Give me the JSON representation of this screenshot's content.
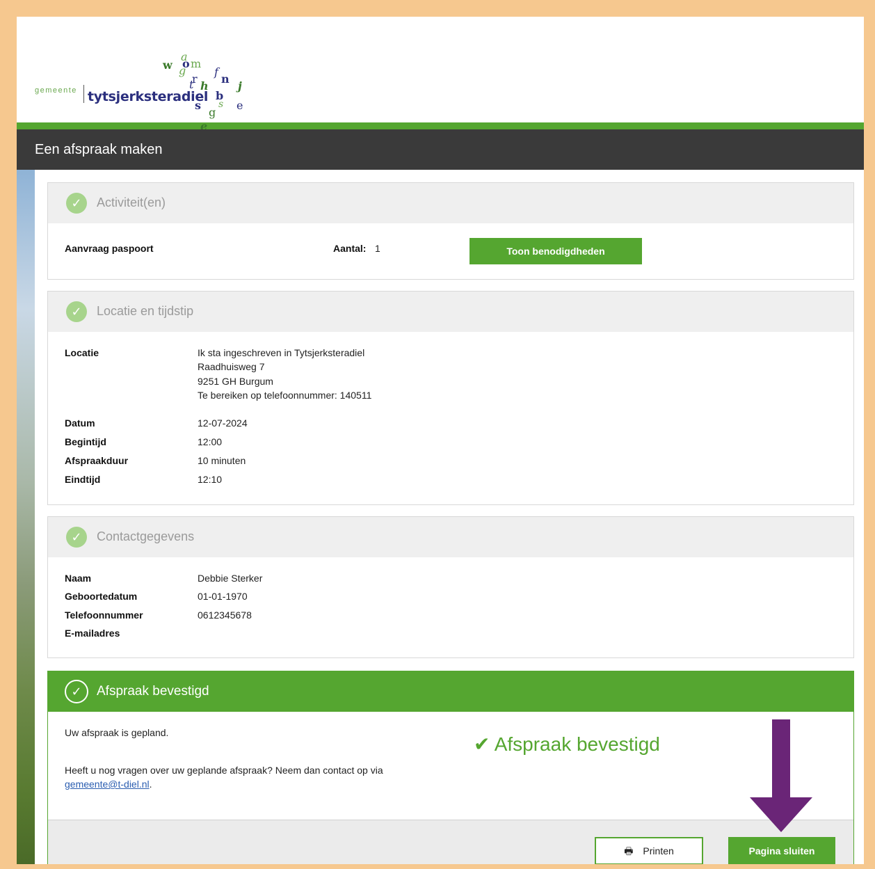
{
  "app": {
    "title": "Een afspraak maken"
  },
  "logo": {
    "prefix": "gemeente",
    "name": "tytsjerksteradiel"
  },
  "activiteiten": {
    "heading": "Activiteit(en)",
    "item": "Aanvraag paspoort",
    "aantal_label": "Aantal:",
    "aantal_value": "1",
    "button": "Toon benodigdheden"
  },
  "locatie": {
    "heading": "Locatie en tijdstip",
    "rows": [
      {
        "label": "Locatie",
        "lines": [
          "Ik sta ingeschreven in Tytsjerksteradiel",
          "Raadhuisweg 7",
          "9251 GH Burgum",
          "Te bereiken op telefoonnummer: 140511"
        ]
      },
      {
        "label": "Datum",
        "value": "12-07-2024"
      },
      {
        "label": "Begintijd",
        "value": "12:00"
      },
      {
        "label": "Afspraakduur",
        "value": "10 minuten"
      },
      {
        "label": "Eindtijd",
        "value": "12:10"
      }
    ]
  },
  "contact": {
    "heading": "Contactgegevens",
    "rows": [
      {
        "label": "Naam",
        "value": "Debbie Sterker"
      },
      {
        "label": "Geboortedatum",
        "value": "01-01-1970"
      },
      {
        "label": "Telefoonnummer",
        "value": "0612345678"
      },
      {
        "label": "E-mailadres",
        "value": ""
      }
    ]
  },
  "bevestiging": {
    "heading": "Afspraak bevestigd",
    "text1": "Uw afspraak is gepland.",
    "text2": "Heeft u nog vragen over uw geplande afspraak? Neem dan contact op via",
    "email": "gemeente@t-diel.nl",
    "after_email": ".",
    "status": "Afspraak bevestigd"
  },
  "footer": {
    "print_label": "Printen",
    "close_label": "Pagina sluiten"
  },
  "colors": {
    "accent": "#55a630",
    "titlebar": "#3a3a3a",
    "arrow": "#6a2577",
    "frame": "#f6c88f"
  }
}
